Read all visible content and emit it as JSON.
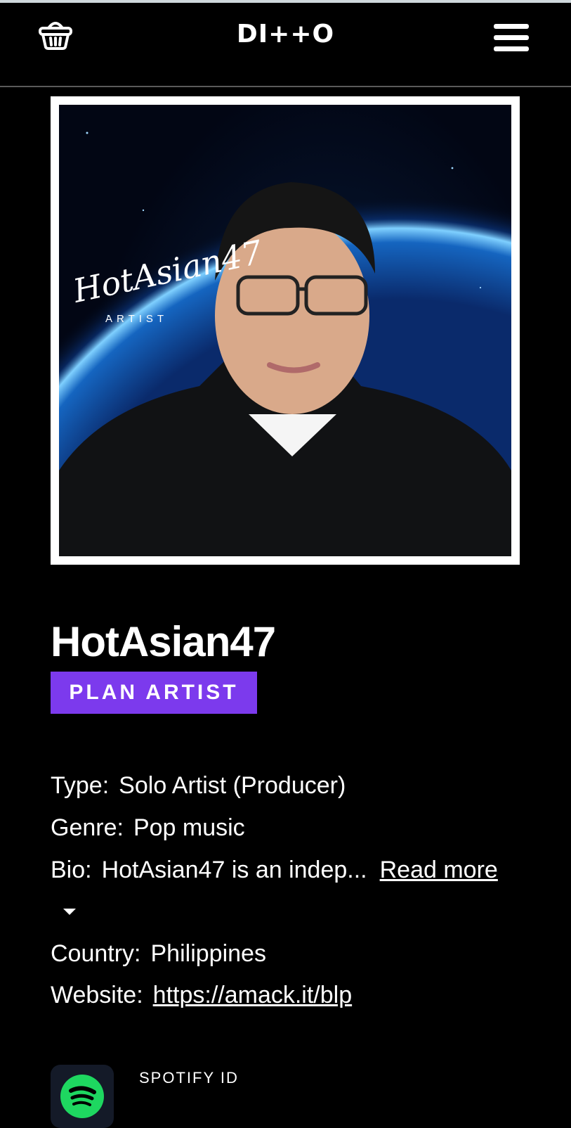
{
  "header": {
    "logo": "DI++O",
    "basket_icon": "basket-icon",
    "menu_icon": "hamburger-menu-icon"
  },
  "artist": {
    "photo_overlay_name": "HotAsian47",
    "photo_overlay_sub": "ARTIST",
    "name": "HotAsian47",
    "badge": "PLAN ARTIST",
    "badge_color": "#7c3aed"
  },
  "info": {
    "type_label": "Type:",
    "type_value": "Solo Artist (Producer)",
    "genre_label": "Genre:",
    "genre_value": "Pop music",
    "bio_label": "Bio:",
    "bio_value": "HotAsian47 is an indep...",
    "read_more": "Read more",
    "country_label": "Country:",
    "country_value": "Philippines",
    "website_label": "Website:",
    "website_value": "https://amack.it/blp"
  },
  "spotify": {
    "label": "SPOTIFY ID",
    "icon": "spotify-icon",
    "color": "#1ed760"
  }
}
